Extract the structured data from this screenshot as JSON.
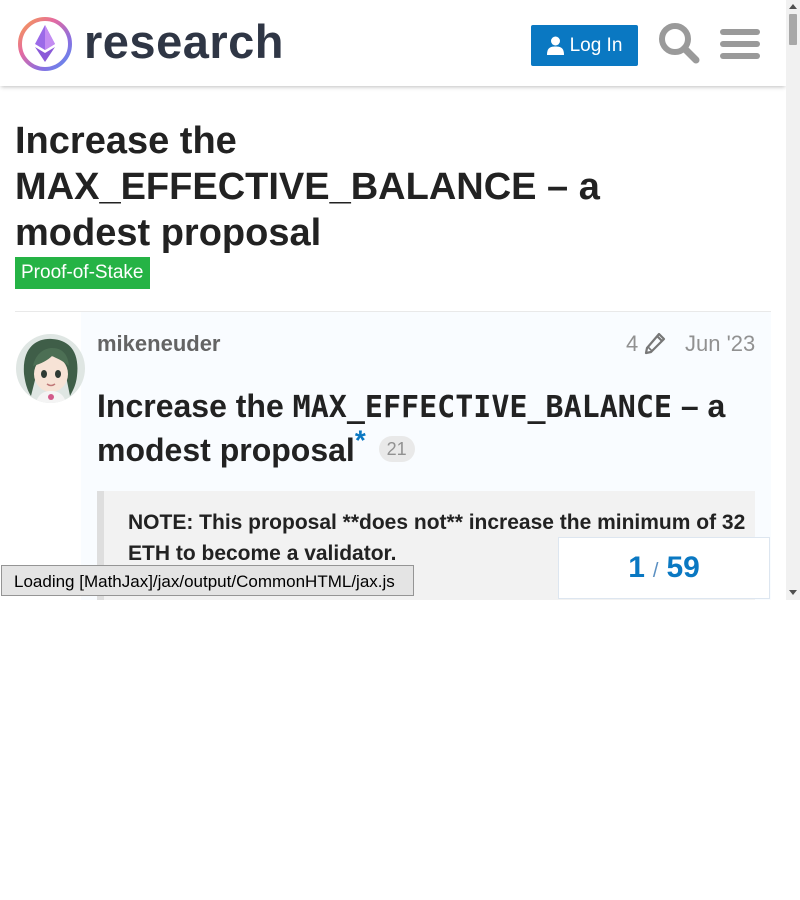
{
  "header": {
    "site_name": "research",
    "login_label": "Log In",
    "search_icon": "search-icon",
    "menu_icon": "hamburger-menu-icon"
  },
  "topic": {
    "title": "Increase the MAX_EFFECTIVE_BALANCE – a modest proposal",
    "category": "Proof-of-Stake",
    "category_color": "#25b345"
  },
  "post": {
    "username": "mikeneuder",
    "edit_count": "4",
    "date": "Jun '23",
    "heading_prefix": "Increase the",
    "heading_code": "MAX_EFFECTIVE_BALANCE",
    "heading_suffix": "– a modest proposal",
    "anchor": "*",
    "click_count": "21",
    "quote_text": "NOTE: This proposal **does not** increase the minimum of 32 ETH to become a validator."
  },
  "progress": {
    "current": "1",
    "separator": "/",
    "total": "59"
  },
  "mathjax_message": "Loading [MathJax]/jax/output/CommonHTML/jax.js",
  "colors": {
    "accent": "#0a78c2",
    "text": "#222222",
    "muted": "#919191"
  }
}
